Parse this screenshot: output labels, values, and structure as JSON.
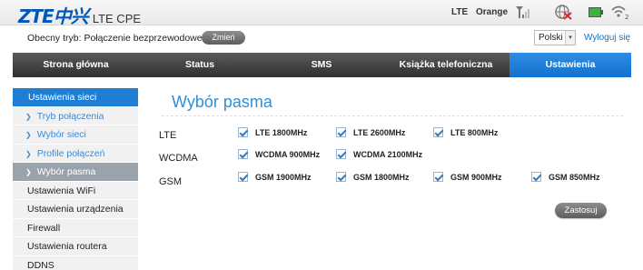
{
  "header": {
    "brand": "ZTE中兴",
    "product": "LTE CPE",
    "network_type": "LTE",
    "operator": "Orange",
    "icons": [
      "signal-icon",
      "globe-disconnected-icon",
      "battery-icon",
      "wifi-icon"
    ],
    "wifi_clients": "2"
  },
  "mode": {
    "text": "Obecny tryb: Połączenie bezprzewodowe",
    "change_label": "Zmień",
    "language": "Polski",
    "logout_label": "Wyloguj się"
  },
  "nav": {
    "tabs": [
      {
        "label": "Strona główna"
      },
      {
        "label": "Status"
      },
      {
        "label": "SMS"
      },
      {
        "label": "Książka telefoniczna"
      },
      {
        "label": "Ustawienia",
        "active": true
      }
    ]
  },
  "sidebar": {
    "items": [
      {
        "label": "Ustawienia sieci",
        "kind": "header"
      },
      {
        "label": "Tryb połączenia",
        "kind": "sub"
      },
      {
        "label": "Wybór sieci",
        "kind": "sub"
      },
      {
        "label": "Profile połączeń",
        "kind": "sub"
      },
      {
        "label": "Wybór pasma",
        "kind": "sub",
        "active": true
      },
      {
        "label": "Ustawienia WiFi",
        "kind": "plain"
      },
      {
        "label": "Ustawienia urządzenia",
        "kind": "plain"
      },
      {
        "label": "Firewall",
        "kind": "plain"
      },
      {
        "label": "Ustawienia routera",
        "kind": "plain"
      },
      {
        "label": "DDNS",
        "kind": "plain"
      }
    ]
  },
  "content": {
    "title": "Wybór pasma",
    "rows": [
      {
        "label": "LTE",
        "bands": [
          {
            "label": "LTE 1800MHz",
            "checked": true
          },
          {
            "label": "LTE 2600MHz",
            "checked": true
          },
          {
            "label": "LTE 800MHz",
            "checked": true
          }
        ]
      },
      {
        "label": "WCDMA",
        "bands": [
          {
            "label": "WCDMA 900MHz",
            "checked": true
          },
          {
            "label": "WCDMA 2100MHz",
            "checked": true
          }
        ]
      },
      {
        "label": "GSM",
        "bands": [
          {
            "label": "GSM 1900MHz",
            "checked": true
          },
          {
            "label": "GSM 1800MHz",
            "checked": true
          },
          {
            "label": "GSM 900MHz",
            "checked": true
          },
          {
            "label": "GSM 850MHz",
            "checked": true
          }
        ]
      }
    ],
    "apply_label": "Zastosuj"
  },
  "colors": {
    "accent": "#1d7ed4",
    "title": "#2d8fd8",
    "nav_bg": "#3a3a3a",
    "button": "#6e6e6e"
  }
}
